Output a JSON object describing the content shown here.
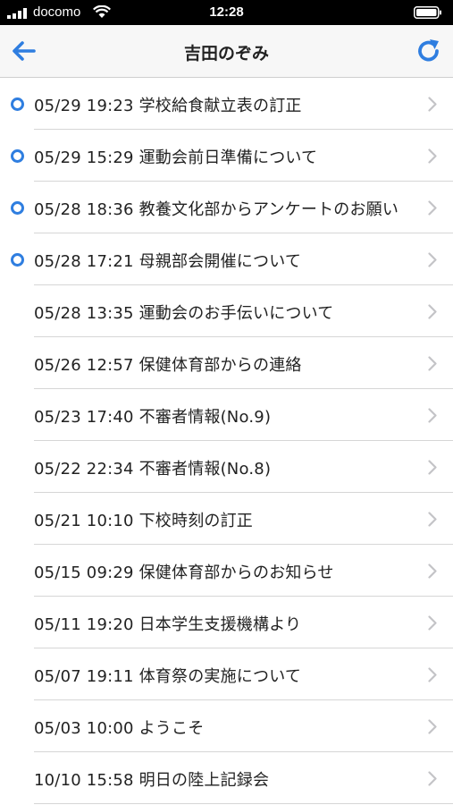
{
  "status_bar": {
    "carrier": "docomo",
    "time": "12:28",
    "icons": [
      "signal-bars-icon",
      "wifi-icon",
      "battery-icon"
    ]
  },
  "nav": {
    "title": "吉田のぞみ",
    "back_icon": "back-arrow-icon",
    "refresh_icon": "refresh-icon",
    "accent_color": "#2f7ee0"
  },
  "messages": [
    {
      "text": "05/29 19:23 学校給食献立表の訂正",
      "unread": true
    },
    {
      "text": "05/29 15:29 運動会前日準備について",
      "unread": true
    },
    {
      "text": "05/28 18:36 教養文化部からアンケートのお願い",
      "unread": true
    },
    {
      "text": "05/28 17:21 母親部会開催について",
      "unread": true
    },
    {
      "text": "05/28 13:35 運動会のお手伝いについて",
      "unread": false
    },
    {
      "text": "05/26 12:57 保健体育部からの連絡",
      "unread": false
    },
    {
      "text": "05/23 17:40 不審者情報(No.9)",
      "unread": false
    },
    {
      "text": "05/22 22:34 不審者情報(No.8)",
      "unread": false
    },
    {
      "text": "05/21 10:10 下校時刻の訂正",
      "unread": false
    },
    {
      "text": "05/15 09:29 保健体育部からのお知らせ",
      "unread": false
    },
    {
      "text": "05/11 19:20 日本学生支援機構より",
      "unread": false
    },
    {
      "text": "05/07 19:11 体育祭の実施について",
      "unread": false
    },
    {
      "text": "05/03 10:00 ようこそ",
      "unread": false
    },
    {
      "text": "10/10 15:58 明日の陸上記録会",
      "unread": false
    }
  ]
}
